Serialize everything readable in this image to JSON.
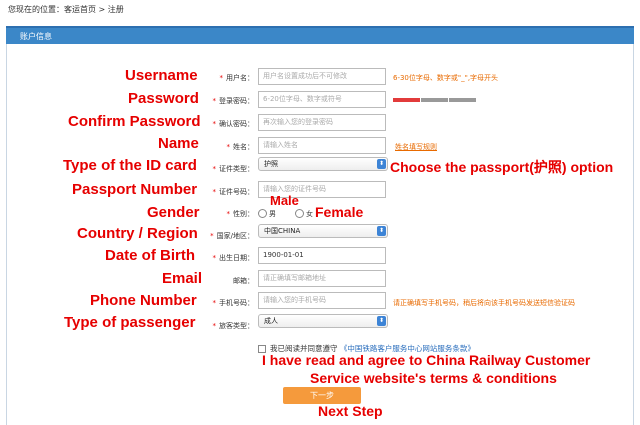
{
  "breadcrumb": "您现在的位置：客运首页 > 注册",
  "panel_title": "账户信息",
  "annotations": {
    "username": "Username",
    "password": "Password",
    "confirm": "Confirm Password",
    "name": "Name",
    "id_type": "Type of the ID card",
    "passport_option": "Choose the passport(护照) option",
    "passport_number": "Passport Number",
    "male": "Male",
    "gender": "Gender",
    "female": "Female",
    "country": "Country / Region",
    "dob": "Date of Birth",
    "email": "Email",
    "phone": "Phone Number",
    "passenger": "Type of passenger",
    "agree_1": "I have read and agree to China Railway Customer",
    "agree_2": "Service website's terms & conditions",
    "next": "Next Step"
  },
  "form": {
    "username_label": "用户名：",
    "username_ph": "用户名设置成功后不可修改",
    "username_hint": "6-30位字母、数字或\"_\",字母开头",
    "password_label": "登录密码：",
    "password_ph": "6-20位字母、数字或符号",
    "confirm_label": "确认密码：",
    "confirm_ph": "再次输入您的登录密码",
    "name_label": "姓名：",
    "name_ph": "请输入姓名",
    "name_hint": "姓名填写规则",
    "id_type_label": "证件类型：",
    "id_type_value": "护照",
    "id_num_label": "证件号码：",
    "id_num_ph": "请输入您的证件号码",
    "gender_label": "性别：",
    "male": "男",
    "female": "女",
    "country_label": "国家/地区：",
    "country_value": "中国CHINA",
    "dob_label": "出生日期：",
    "dob_value": "1900-01-01",
    "email_label": "邮箱：",
    "email_ph": "请正确填写邮箱地址",
    "phone_label": "手机号码：",
    "phone_ph": "请输入您的手机号码",
    "phone_hint": "请正确填写手机号码，稍后将向该手机号码发送短信验证码",
    "passenger_label": "旅客类型：",
    "passenger_value": "成人",
    "agree_text": "我已阅读并同意遵守",
    "agree_link": "《中国铁路客户服务中心网站服务条款》",
    "next_button": "下一步"
  },
  "colors": {
    "annotation": "#e60000",
    "header": "#3b87c8",
    "button": "#f59a3c",
    "hint": "#e86a00"
  }
}
